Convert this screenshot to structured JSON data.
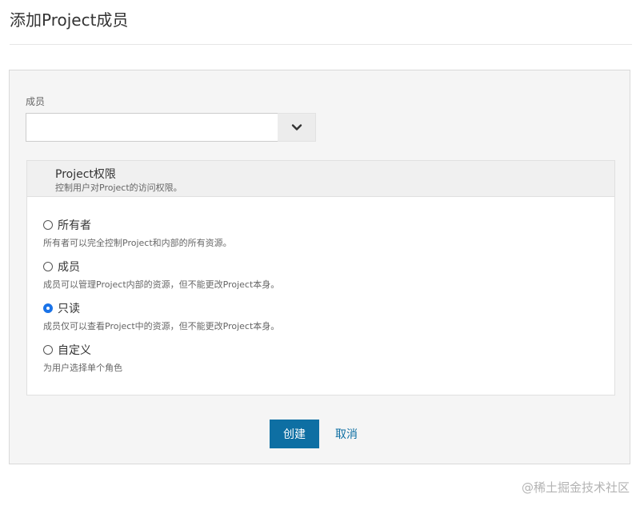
{
  "page": {
    "title": "添加Project成员"
  },
  "member_field": {
    "label": "成员",
    "value": "",
    "toggle_icon": "chevron-down-icon"
  },
  "permissions": {
    "title": "Project权限",
    "description": "控制用户对Project的访问权限。",
    "options": [
      {
        "label": "所有者",
        "description": "所有者可以完全控制Project和内部的所有资源。",
        "checked": false
      },
      {
        "label": "成员",
        "description": "成员可以管理Project内部的资源，但不能更改Project本身。",
        "checked": false
      },
      {
        "label": "只读",
        "description": "成员仅可以查看Project中的资源，但不能更改Project本身。",
        "checked": true
      },
      {
        "label": "自定义",
        "description": "为用户选择单个角色",
        "checked": false
      }
    ]
  },
  "actions": {
    "create_label": "创建",
    "cancel_label": "取消"
  },
  "watermark": "@稀土掘金技术社区",
  "colors": {
    "primary": "#0e6fa3",
    "radio_checked": "#1a73e8"
  }
}
